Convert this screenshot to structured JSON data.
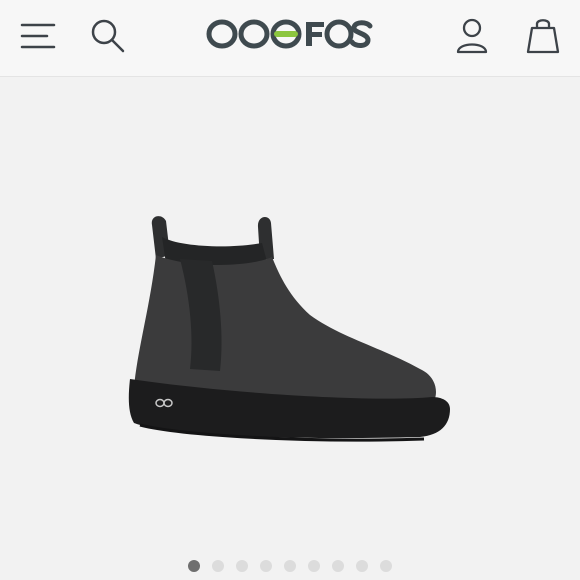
{
  "header": {
    "brand": "OOFOS",
    "menu_icon": "hamburger-menu-icon",
    "search_icon": "search-icon",
    "account_icon": "account-icon",
    "bag_icon": "shopping-bag-icon"
  },
  "colors": {
    "logo_gray": "#3f4a4f",
    "logo_accent": "#8cc63f",
    "icon_stroke": "#3d4349",
    "background": "#f2f2f2"
  },
  "product": {
    "image_subject": "boot"
  },
  "gallery": {
    "total_images": 9,
    "active_index": 0
  }
}
